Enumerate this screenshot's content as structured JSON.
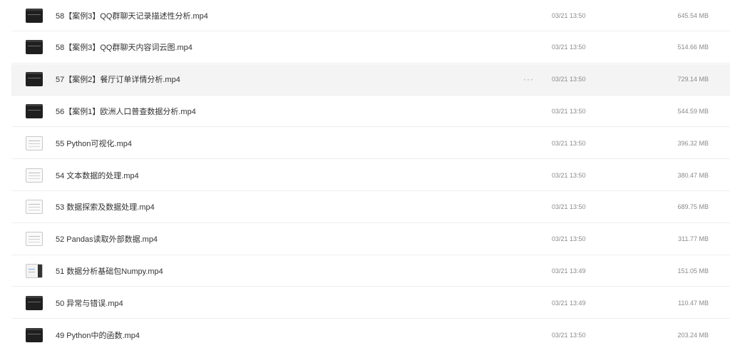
{
  "files": [
    {
      "name": "58【案例3】QQ群聊天记录描述性分析.mp4",
      "date": "03/21 13:50",
      "size": "645.54 MB",
      "thumbnail": "dark"
    },
    {
      "name": "58【案例3】QQ群聊天内容词云图.mp4",
      "date": "03/21 13:50",
      "size": "514.66 MB",
      "thumbnail": "dark"
    },
    {
      "name": "57【案例2】餐厅订单详情分析.mp4",
      "date": "03/21 13:50",
      "size": "729.14 MB",
      "thumbnail": "dark",
      "hovered": true,
      "more_icon": "···"
    },
    {
      "name": "56【案例1】欧洲人口普查数据分析.mp4",
      "date": "03/21 13:50",
      "size": "544.59 MB",
      "thumbnail": "dark"
    },
    {
      "name": "55 Python可视化.mp4",
      "date": "03/21 13:50",
      "size": "396.32 MB",
      "thumbnail": "light"
    },
    {
      "name": "54 文本数据的处理.mp4",
      "date": "03/21 13:50",
      "size": "380.47 MB",
      "thumbnail": "light"
    },
    {
      "name": "53 数据探索及数据处理.mp4",
      "date": "03/21 13:50",
      "size": "689.75 MB",
      "thumbnail": "light"
    },
    {
      "name": "52 Pandas读取外部数据.mp4",
      "date": "03/21 13:50",
      "size": "311.77 MB",
      "thumbnail": "light"
    },
    {
      "name": "51 数据分析基础包Numpy.mp4",
      "date": "03/21 13:49",
      "size": "151.05 MB",
      "thumbnail": "mixed"
    },
    {
      "name": "50 异常与错误.mp4",
      "date": "03/21 13:49",
      "size": "110.47 MB",
      "thumbnail": "dark"
    },
    {
      "name": "49 Python中的函数.mp4",
      "date": "03/21 13:50",
      "size": "203.24 MB",
      "thumbnail": "dark"
    }
  ]
}
